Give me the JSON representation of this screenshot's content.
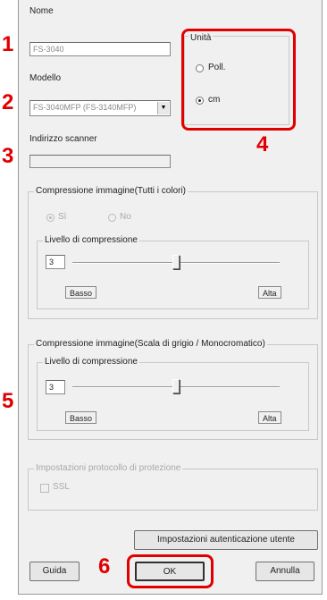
{
  "dialog": {
    "name_label": "Nome",
    "name_value": "FS-3040",
    "model_label": "Modello",
    "model_value": "FS-3040MFP (FS-3140MFP)",
    "scanner_address_label": "Indirizzo scanner",
    "scanner_address_value": "",
    "units": {
      "title": "Unità",
      "options": [
        "Poll.",
        "cm"
      ],
      "selected": "cm"
    },
    "compression_color": {
      "title": "Compressione immagine(Tutti i colori)",
      "yes_label": "Sì",
      "no_label": "No",
      "level_title": "Livello di compressione",
      "level_value": "3",
      "low_label": "Basso",
      "high_label": "Alta",
      "slider_fraction": 0.5
    },
    "compression_gray": {
      "title": "Compressione immagine(Scala di grigio / Monocromatico)",
      "level_title": "Livello di compressione",
      "level_value": "3",
      "low_label": "Basso",
      "high_label": "Alta",
      "slider_fraction": 0.5
    },
    "protection": {
      "title": "Impostazioni protocollo di protezione",
      "ssl_label": "SSL"
    },
    "user_auth_button": "Impostazioni autenticazione utente",
    "help_button": "Guida",
    "ok_button": "OK",
    "cancel_button": "Annulla"
  },
  "callouts": [
    "1",
    "2",
    "3",
    "4",
    "5",
    "6"
  ],
  "colors": {
    "callout": "#e00000",
    "dialog_bg": "#f0f0f0"
  }
}
